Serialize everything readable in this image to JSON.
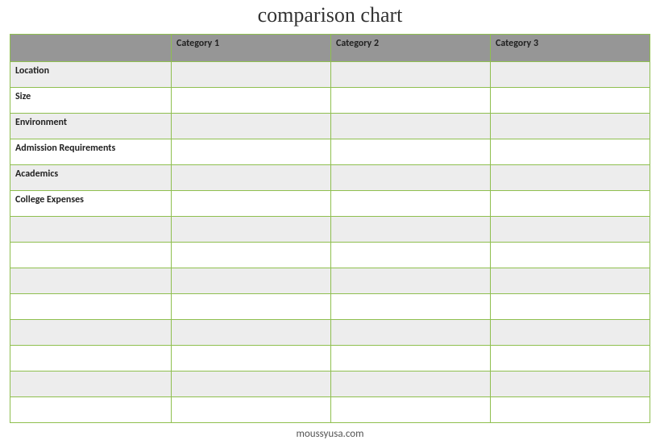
{
  "title": "comparison chart",
  "columns": [
    "",
    "Category 1",
    "Category 2",
    "Category 3"
  ],
  "rows": [
    {
      "label": "Location",
      "c1": "",
      "c2": "",
      "c3": ""
    },
    {
      "label": "Size",
      "c1": "",
      "c2": "",
      "c3": ""
    },
    {
      "label": "Environment",
      "c1": "",
      "c2": "",
      "c3": ""
    },
    {
      "label": "Admission Requirements",
      "c1": "",
      "c2": "",
      "c3": ""
    },
    {
      "label": "Academics",
      "c1": "",
      "c2": "",
      "c3": ""
    },
    {
      "label": "College Expenses",
      "c1": "",
      "c2": "",
      "c3": ""
    },
    {
      "label": "",
      "c1": "",
      "c2": "",
      "c3": ""
    },
    {
      "label": "",
      "c1": "",
      "c2": "",
      "c3": ""
    },
    {
      "label": "",
      "c1": "",
      "c2": "",
      "c3": ""
    },
    {
      "label": "",
      "c1": "",
      "c2": "",
      "c3": ""
    },
    {
      "label": "",
      "c1": "",
      "c2": "",
      "c3": ""
    },
    {
      "label": "",
      "c1": "",
      "c2": "",
      "c3": ""
    },
    {
      "label": "",
      "c1": "",
      "c2": "",
      "c3": ""
    },
    {
      "label": "",
      "c1": "",
      "c2": "",
      "c3": ""
    }
  ],
  "footer": "moussyusa.com"
}
